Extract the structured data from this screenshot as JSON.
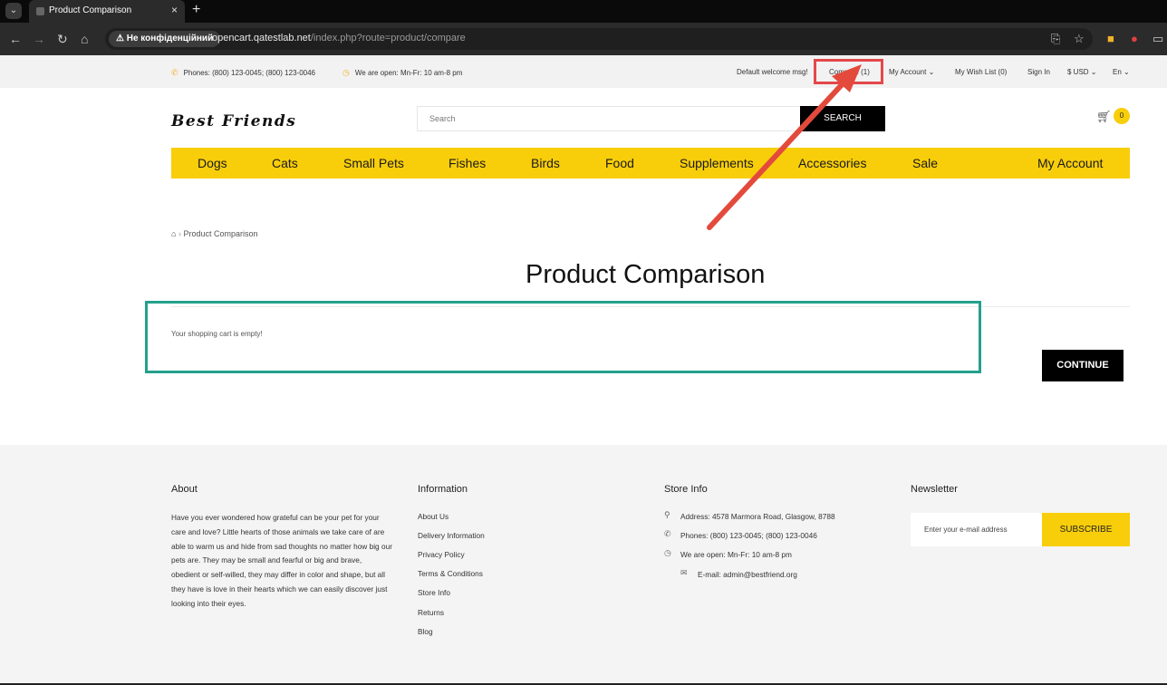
{
  "browser": {
    "tab_title": "Product Comparison",
    "tab_close": "×",
    "new_tab": "+",
    "security_label": "⚠ Не конфіденційний",
    "url_host": "opencart.qatestlab.net",
    "url_path": "/index.php?route=product/compare"
  },
  "topbar": {
    "phones": "Phones: (800) 123-0045; (800) 123-0046",
    "open_hours": "We are open: Mn-Fr: 10 am-8 pm",
    "welcome": "Default welcome msg!",
    "compare": "Compare (1)",
    "my_account": "My Account ⌄",
    "wish_list": "My Wish List (0)",
    "sign_in": "Sign In",
    "currency": "$ USD ⌄",
    "language": "En ⌄"
  },
  "header": {
    "logo": "Best Friends",
    "search_placeholder": "Search",
    "search_button": "SEARCH",
    "cart_count": "0"
  },
  "nav": {
    "items": [
      "Dogs",
      "Cats",
      "Small Pets",
      "Fishes",
      "Birds",
      "Food",
      "Supplements",
      "Accessories",
      "Sale",
      "My Account"
    ]
  },
  "page": {
    "breadcrumb_current": "Product Comparison",
    "title": "Product Comparison",
    "empty_message": "Your shopping cart is empty!",
    "continue_button": "CONTINUE"
  },
  "footer": {
    "about": {
      "title": "About",
      "text": "Have you ever wondered how grateful can be your pet for your care and love? Little hearts of those animals we take care of are able to warm us and hide from sad thoughts no matter how big our pets are. They may be small and fearful or big and brave, obedient or self-willed, they may differ in color and shape, but all they have is love in their hearts which we can easily discover just looking into their eyes."
    },
    "information": {
      "title": "Information",
      "links": [
        "About Us",
        "Delivery Information",
        "Privacy Policy",
        "Terms & Conditions",
        "Store Info",
        "Returns",
        "Blog"
      ]
    },
    "store_info": {
      "title": "Store Info",
      "address": "Address: 4578 Marmora Road, Glasgow, 8788",
      "phones": "Phones: (800) 123-0045; (800) 123-0046",
      "hours": "We are open: Mn-Fr: 10 am-8 pm",
      "email": "E-mail: admin@bestfriend.org"
    },
    "newsletter": {
      "title": "Newsletter",
      "placeholder": "Enter your e-mail address",
      "button": "SUBSCRIBE"
    }
  },
  "colors": {
    "accent_yellow": "#f8ce0b",
    "annotation_red": "#e3484b",
    "annotation_teal": "#23a08c"
  }
}
